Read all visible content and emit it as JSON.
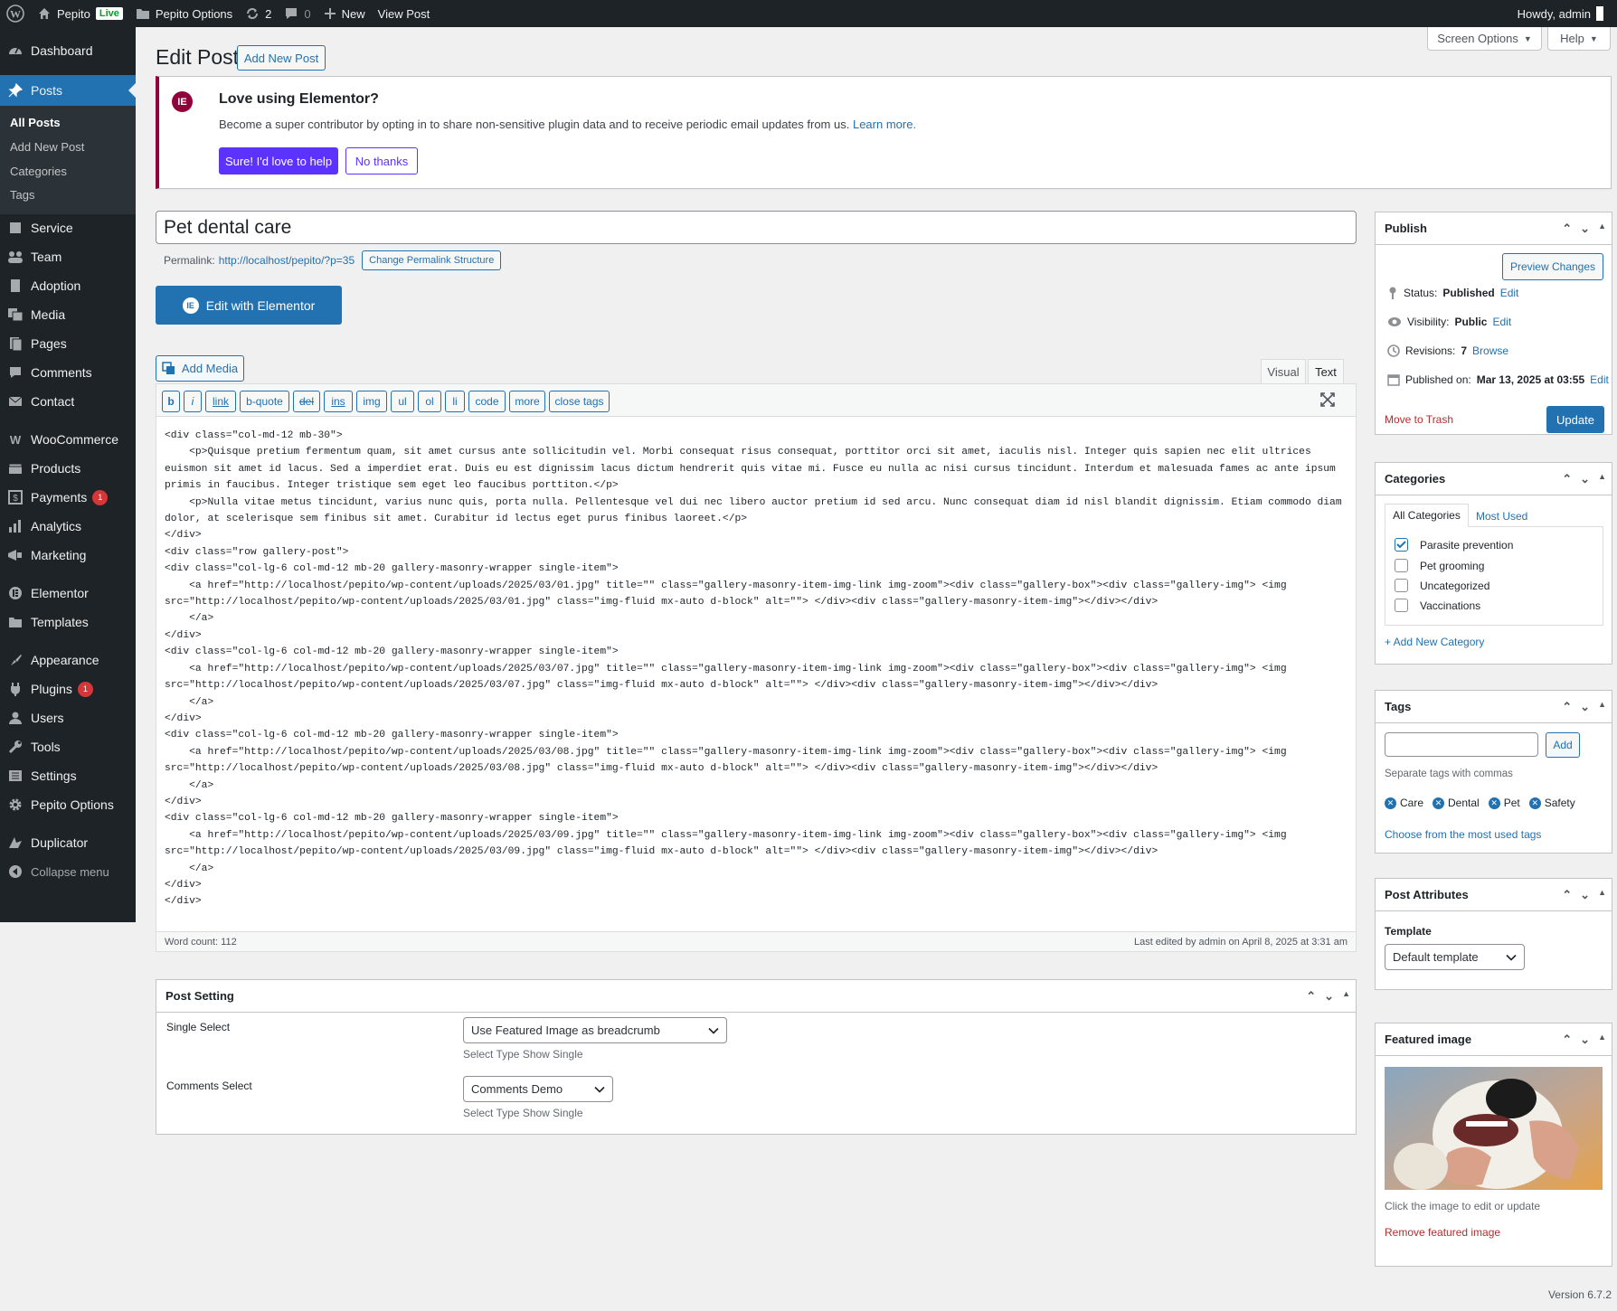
{
  "adminbar": {
    "site_name": "Pepito",
    "live_badge": "Live",
    "options": "Pepito Options",
    "updates_count": "2",
    "comments_count": "0",
    "new_label": "New",
    "view_post": "View Post",
    "howdy": "Howdy, admin"
  },
  "sidebar": {
    "items": [
      {
        "label": "Dashboard",
        "icon": "dashboard-icon"
      },
      {
        "label": "Posts",
        "icon": "pin-icon"
      },
      {
        "label": "Service",
        "icon": "service-icon"
      },
      {
        "label": "Team",
        "icon": "team-icon"
      },
      {
        "label": "Adoption",
        "icon": "adoption-icon"
      },
      {
        "label": "Media",
        "icon": "media-icon"
      },
      {
        "label": "Pages",
        "icon": "pages-icon"
      },
      {
        "label": "Comments",
        "icon": "comments-icon"
      },
      {
        "label": "Contact",
        "icon": "mail-icon"
      },
      {
        "label": "WooCommerce",
        "icon": "woocommerce-icon"
      },
      {
        "label": "Products",
        "icon": "products-icon"
      },
      {
        "label": "Payments",
        "icon": "payments-icon",
        "badge": "1"
      },
      {
        "label": "Analytics",
        "icon": "analytics-icon"
      },
      {
        "label": "Marketing",
        "icon": "marketing-icon"
      },
      {
        "label": "Elementor",
        "icon": "elementor-icon"
      },
      {
        "label": "Templates",
        "icon": "folder-icon"
      },
      {
        "label": "Appearance",
        "icon": "appearance-icon"
      },
      {
        "label": "Plugins",
        "icon": "plugins-icon",
        "badge": "1"
      },
      {
        "label": "Users",
        "icon": "users-icon"
      },
      {
        "label": "Tools",
        "icon": "tools-icon"
      },
      {
        "label": "Settings",
        "icon": "settings-icon"
      },
      {
        "label": "Pepito Options",
        "icon": "gear-icon"
      },
      {
        "label": "Duplicator",
        "icon": "duplicator-icon"
      }
    ],
    "submenu": [
      "All Posts",
      "Add New Post",
      "Categories",
      "Tags"
    ],
    "collapse": "Collapse menu"
  },
  "header": {
    "title": "Edit Post",
    "add_new": "Add New Post",
    "screen_options": "Screen Options",
    "help": "Help"
  },
  "notice": {
    "title": "Love using Elementor?",
    "desc": "Become a super contributor by opting in to share non-sensitive plugin data and to receive periodic email updates from us.",
    "learn_more": "Learn more.",
    "accept": "Sure! I'd love to help",
    "decline": "No thanks"
  },
  "post": {
    "title": "Pet dental care",
    "permalink_label": "Permalink:",
    "permalink_url": "http://localhost/pepito/?p=35",
    "change_permalink": "Change Permalink Structure",
    "edit_elementor": "Edit with Elementor",
    "add_media": "Add Media"
  },
  "editor": {
    "tab_visual": "Visual",
    "tab_text": "Text",
    "quicktags": [
      "b",
      "i",
      "link",
      "b-quote",
      "del",
      "ins",
      "img",
      "ul",
      "ol",
      "li",
      "code",
      "more",
      "close tags"
    ],
    "content": "<div class=\"col-md-12 mb-30\">\n    <p>Quisque pretium fermentum quam, sit amet cursus ante sollicitudin vel. Morbi consequat risus consequat, porttitor orci sit amet, iaculis nisl. Integer quis sapien nec elit ultrices\neuismon sit amet id lacus. Sed a imperdiet erat. Duis eu est dignissim lacus dictum hendrerit quis vitae mi. Fusce eu nulla ac nisi cursus tincidunt. Interdum et malesuada fames ac ante ipsum\nprimis in faucibus. Integer tristique sem eget leo faucibus porttiton.</p>\n    <p>Nulla vitae metus tincidunt, varius nunc quis, porta nulla. Pellentesque vel dui nec libero auctor pretium id sed arcu. Nunc consequat diam id nisl blandit dignissim. Etiam commodo diam\ndolor, at scelerisque sem finibus sit amet. Curabitur id lectus eget purus finibus laoreet.</p>\n</div>\n<div class=\"row gallery-post\">\n<div class=\"col-lg-6 col-md-12 mb-20 gallery-masonry-wrapper single-item\">\n    <a href=\"http://localhost/pepito/wp-content/uploads/2025/03/01.jpg\" title=\"\" class=\"gallery-masonry-item-img-link img-zoom\"><div class=\"gallery-box\"><div class=\"gallery-img\"> <img\nsrc=\"http://localhost/pepito/wp-content/uploads/2025/03/01.jpg\" class=\"img-fluid mx-auto d-block\" alt=\"\"> </div><div class=\"gallery-masonry-item-img\"></div></div>\n    </a>\n</div>\n<div class=\"col-lg-6 col-md-12 mb-20 gallery-masonry-wrapper single-item\">\n    <a href=\"http://localhost/pepito/wp-content/uploads/2025/03/07.jpg\" title=\"\" class=\"gallery-masonry-item-img-link img-zoom\"><div class=\"gallery-box\"><div class=\"gallery-img\"> <img\nsrc=\"http://localhost/pepito/wp-content/uploads/2025/03/07.jpg\" class=\"img-fluid mx-auto d-block\" alt=\"\"> </div><div class=\"gallery-masonry-item-img\"></div></div>\n    </a>\n</div>\n<div class=\"col-lg-6 col-md-12 mb-20 gallery-masonry-wrapper single-item\">\n    <a href=\"http://localhost/pepito/wp-content/uploads/2025/03/08.jpg\" title=\"\" class=\"gallery-masonry-item-img-link img-zoom\"><div class=\"gallery-box\"><div class=\"gallery-img\"> <img\nsrc=\"http://localhost/pepito/wp-content/uploads/2025/03/08.jpg\" class=\"img-fluid mx-auto d-block\" alt=\"\"> </div><div class=\"gallery-masonry-item-img\"></div></div>\n    </a>\n</div>\n<div class=\"col-lg-6 col-md-12 mb-20 gallery-masonry-wrapper single-item\">\n    <a href=\"http://localhost/pepito/wp-content/uploads/2025/03/09.jpg\" title=\"\" class=\"gallery-masonry-item-img-link img-zoom\"><div class=\"gallery-box\"><div class=\"gallery-img\"> <img\nsrc=\"http://localhost/pepito/wp-content/uploads/2025/03/09.jpg\" class=\"img-fluid mx-auto d-block\" alt=\"\"> </div><div class=\"gallery-masonry-item-img\"></div></div>\n    </a>\n</div>\n</div>",
    "word_count": "Word count: 112",
    "last_edited": "Last edited by admin on April 8, 2025 at 3:31 am"
  },
  "post_setting": {
    "title": "Post Setting",
    "single_select_label": "Single Select",
    "single_select_value": "Use Featured Image as breadcrumb",
    "single_select_help": "Select Type Show Single",
    "comments_select_label": "Comments Select",
    "comments_select_value": "Comments Demo",
    "comments_select_help": "Select Type Show Single"
  },
  "publish": {
    "title": "Publish",
    "preview": "Preview Changes",
    "status_label": "Status:",
    "status_value": "Published",
    "visibility_label": "Visibility:",
    "visibility_value": "Public",
    "revisions_label": "Revisions:",
    "revisions_value": "7",
    "browse": "Browse",
    "published_on_label": "Published on:",
    "published_on_value": "Mar 13, 2025 at 03:55",
    "edit": "Edit",
    "trash": "Move to Trash",
    "update": "Update"
  },
  "categories": {
    "title": "Categories",
    "tab_all": "All Categories",
    "tab_most_used": "Most Used",
    "items": [
      {
        "label": "Parasite prevention",
        "checked": true
      },
      {
        "label": "Pet grooming",
        "checked": false
      },
      {
        "label": "Uncategorized",
        "checked": false
      },
      {
        "label": "Vaccinations",
        "checked": false
      }
    ],
    "add_new": "+ Add New Category"
  },
  "tags": {
    "title": "Tags",
    "add": "Add",
    "help": "Separate tags with commas",
    "items": [
      "Care",
      "Dental",
      "Pet",
      "Safety"
    ],
    "choose": "Choose from the most used tags"
  },
  "post_attributes": {
    "title": "Post Attributes",
    "template_label": "Template",
    "template_value": "Default template"
  },
  "featured_image": {
    "title": "Featured image",
    "help": "Click the image to edit or update",
    "remove": "Remove featured image"
  },
  "footer": {
    "version": "Version 6.7.2"
  },
  "colors": {
    "admin_dark": "#1d2327",
    "accent": "#2271b1",
    "elementor": "#92003b",
    "elementor_button": "#5c32ff",
    "danger": "#d63638"
  }
}
